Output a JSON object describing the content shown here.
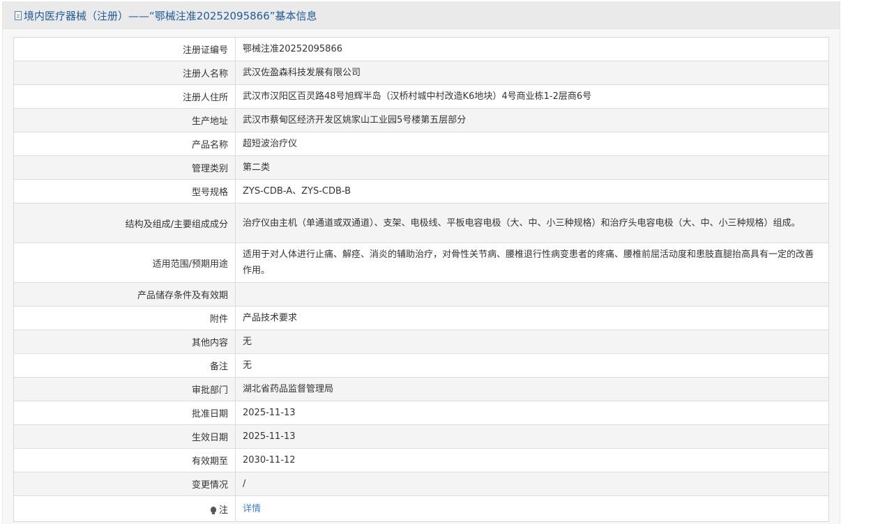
{
  "header": {
    "title": "境内医疗器械（注册）——“鄂械注准20252095866”基本信息"
  },
  "rows": [
    {
      "label": "注册证编号",
      "value": "鄂械注准20252095866"
    },
    {
      "label": "注册人名称",
      "value": "武汉佐盈森科技发展有限公司"
    },
    {
      "label": "注册人住所",
      "value": "武汉市汉阳区百灵路48号旭辉半岛（汉桥村城中村改造K6地块）4号商业栋1-2层商6号"
    },
    {
      "label": "生产地址",
      "value": "武汉市蔡甸区经济开发区姚家山工业园5号楼第五层部分"
    },
    {
      "label": "产品名称",
      "value": "超短波治疗仪"
    },
    {
      "label": "管理类别",
      "value": "第二类"
    },
    {
      "label": "型号规格",
      "value": "ZYS-CDB-A、ZYS-CDB-B"
    },
    {
      "label": "结构及组成/主要组成成分",
      "value": "治疗仪由主机（单通道或双通道）、支架、电极线、平板电容电极（大、中、小三种规格）和治疗头电容电极（大、中、小三种规格）组成。"
    },
    {
      "label": "适用范围/预期用途",
      "value": "适用于对人体进行止痛、解痉、消炎的辅助治疗，对骨性关节病、腰椎退行性病变患者的疼痛、腰椎前屈活动度和患肢直腿抬高具有一定的改善作用。"
    },
    {
      "label": "产品储存条件及有效期",
      "value": ""
    },
    {
      "label": "附件",
      "value": "产品技术要求"
    },
    {
      "label": "其他内容",
      "value": "无"
    },
    {
      "label": "备注",
      "value": "无"
    },
    {
      "label": "审批部门",
      "value": "湖北省药品监督管理局"
    },
    {
      "label": "批准日期",
      "value": "2025-11-13"
    },
    {
      "label": "生效日期",
      "value": "2025-11-13"
    },
    {
      "label": "有效期至",
      "value": "2030-11-12"
    },
    {
      "label": "变更情况",
      "value": "/"
    },
    {
      "label": "注",
      "value": "详情"
    }
  ]
}
